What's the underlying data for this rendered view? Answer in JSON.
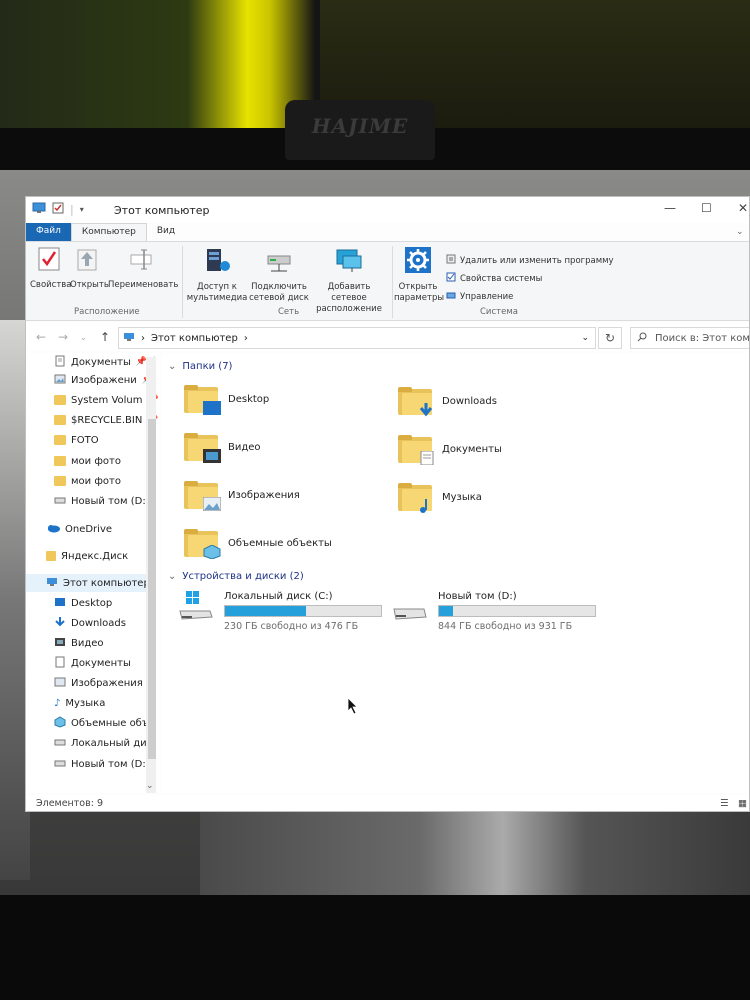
{
  "window": {
    "title": "Этот компьютер"
  },
  "webcam_brand": "HAJIME",
  "tabs": {
    "file": "Файл",
    "computer": "Компьютер",
    "view": "Вид"
  },
  "ribbon": {
    "location": {
      "properties": "Свойства",
      "open": "Открыть",
      "rename": "Переименовать",
      "group": "Расположение"
    },
    "network": {
      "media_access_1": "Доступ к",
      "media_access_2": "мультимедиа",
      "map_drive_1": "Подключить",
      "map_drive_2": "сетевой диск",
      "add_location_1": "Добавить сетевое",
      "add_location_2": "расположение",
      "group": "Сеть"
    },
    "system": {
      "open_settings_1": "Открыть",
      "open_settings_2": "параметры",
      "uninstall": "Удалить или изменить программу",
      "system_properties": "Свойства системы",
      "manage": "Управление",
      "group": "Система"
    }
  },
  "address": {
    "path": "Этот компьютер",
    "search_placeholder": "Поиск в: Этот ком..."
  },
  "nav_pane": {
    "quick_access": [
      {
        "label": "Документы",
        "pinned": true
      },
      {
        "label": "Изображени",
        "pinned": true
      },
      {
        "label": "System Volum",
        "pinned": true
      },
      {
        "label": "$RECYCLE.BIN",
        "pinned": true
      },
      {
        "label": "FOTO",
        "pinned": false
      },
      {
        "label": "мои фото",
        "pinned": false
      },
      {
        "label": "мои фото",
        "pinned": false
      },
      {
        "label": "Новый том (D:)",
        "pinned": false
      }
    ],
    "onedrive": "OneDrive",
    "yandex": "Яндекс.Диск",
    "this_pc": "Этот компьютер",
    "this_pc_children": [
      "Desktop",
      "Downloads",
      "Видео",
      "Документы",
      "Изображения",
      "Музыка",
      "Объемные объ",
      "Локальный дис",
      "Новый том (D:)"
    ]
  },
  "content": {
    "folders_header": "Папки (7)",
    "folders": [
      "Desktop",
      "Downloads",
      "Видео",
      "Документы",
      "Изображения",
      "Музыка",
      "Объемные объекты"
    ],
    "devices_header": "Устройства и диски (2)",
    "drives": [
      {
        "name": "Локальный диск (C:)",
        "free_text": "230 ГБ свободно из 476 ГБ",
        "used_fraction": 0.52
      },
      {
        "name": "Новый том (D:)",
        "free_text": "844 ГБ свободно из 931 ГБ",
        "used_fraction": 0.09
      }
    ]
  },
  "status": {
    "items": "Элементов: 9"
  }
}
